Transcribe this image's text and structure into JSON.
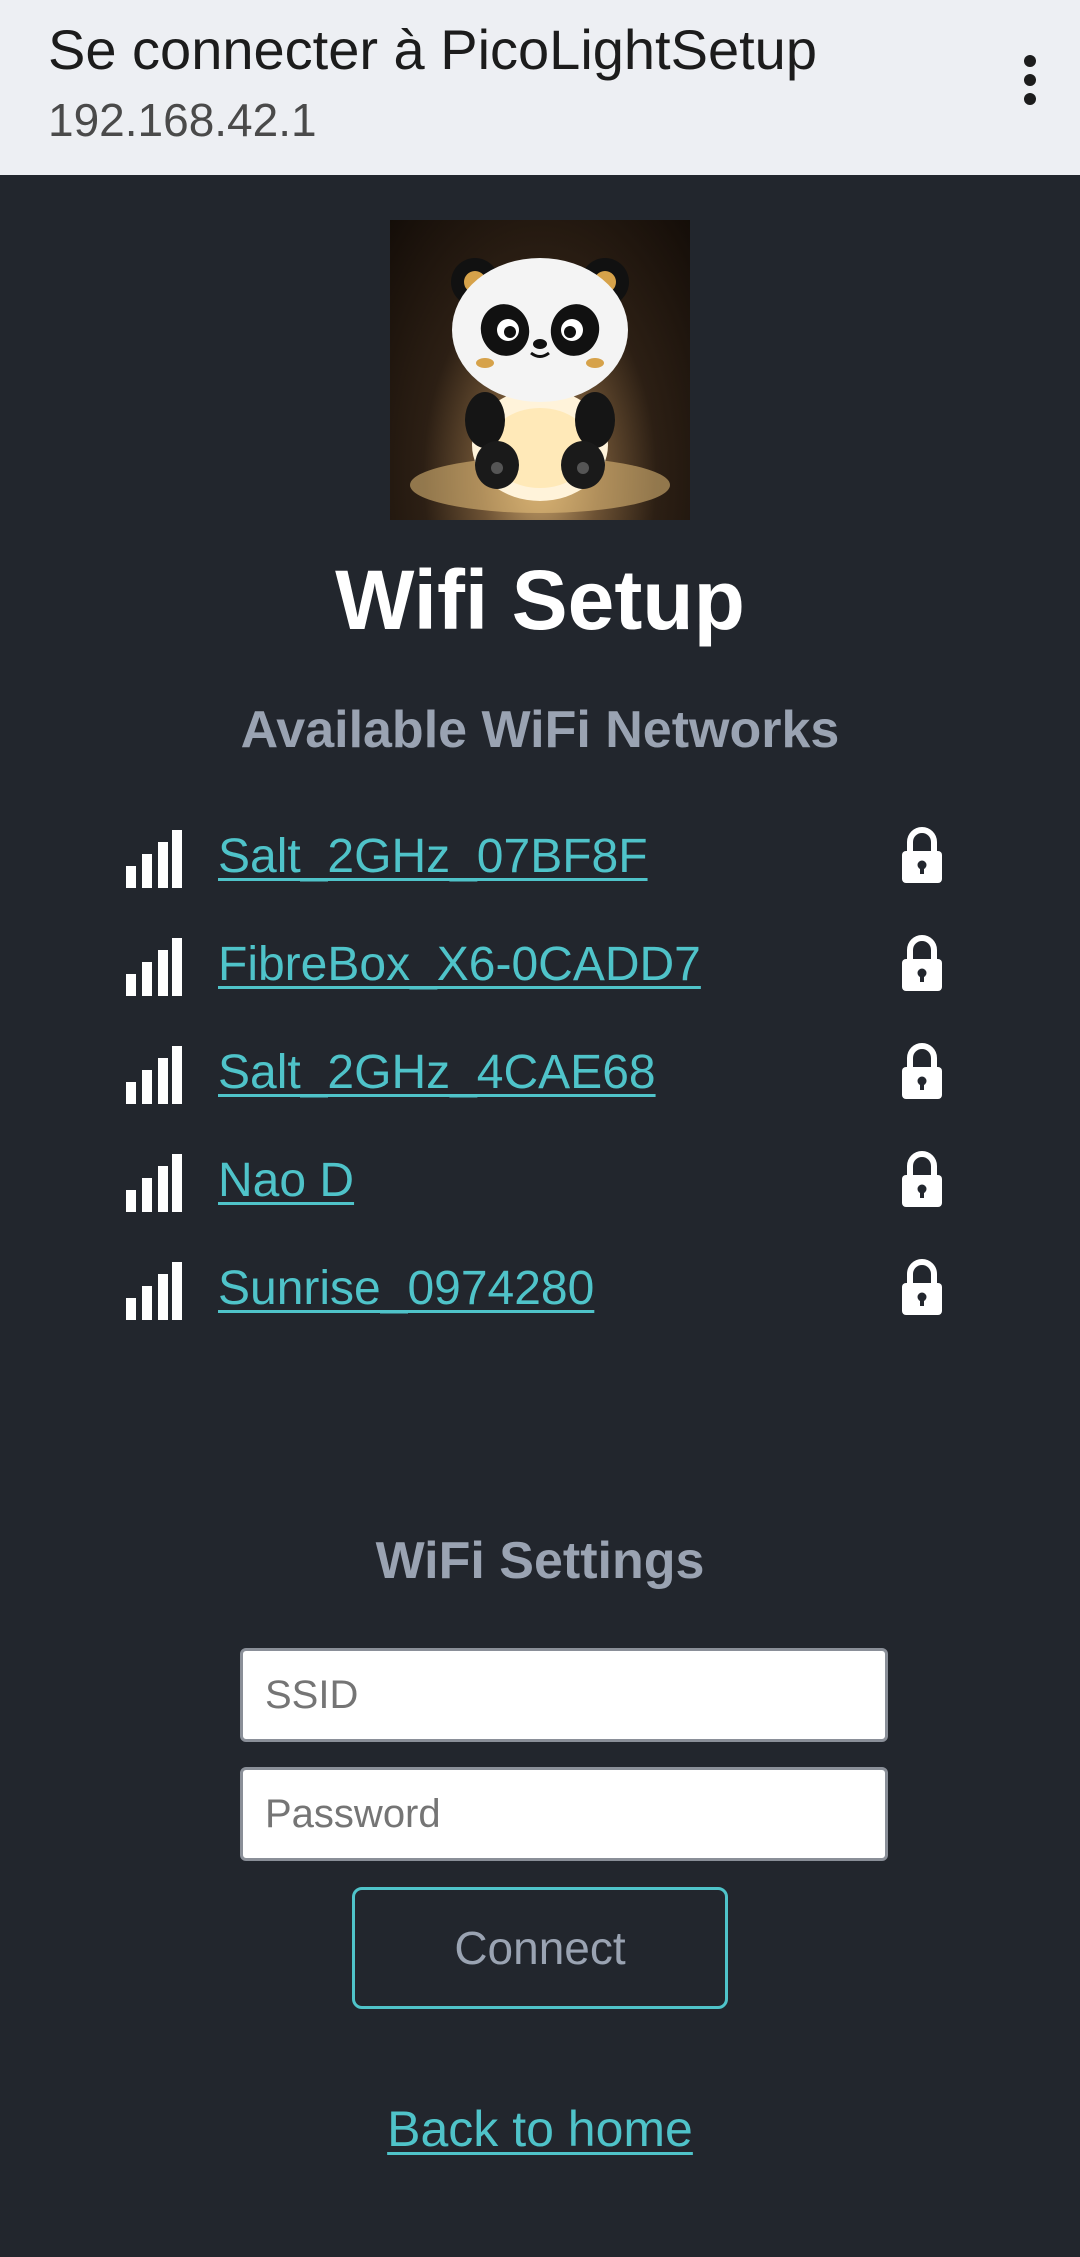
{
  "browser": {
    "title": "Se connecter à PicoLightSetup",
    "url": "192.168.42.1",
    "menu_icon": "more-vert-icon"
  },
  "page": {
    "logo_alt": "panda-lamp-logo",
    "heading": "Wifi Setup",
    "available_heading": "Available WiFi Networks",
    "networks": [
      {
        "ssid": "Salt_2GHz_07BF8F",
        "signal_icon": "signal-icon",
        "secured": true
      },
      {
        "ssid": "FibreBox_X6-0CADD7",
        "signal_icon": "signal-icon",
        "secured": true
      },
      {
        "ssid": "Salt_2GHz_4CAE68",
        "signal_icon": "signal-icon",
        "secured": true
      },
      {
        "ssid": "Nao D",
        "signal_icon": "signal-icon",
        "secured": true
      },
      {
        "ssid": "Sunrise_0974280",
        "signal_icon": "signal-icon",
        "secured": true
      }
    ],
    "settings_heading": "WiFi Settings",
    "ssid_placeholder": "SSID",
    "password_placeholder": "Password",
    "connect_label": "Connect",
    "back_link": "Back to home"
  },
  "colors": {
    "background": "#22262d",
    "accent": "#4fc3c9",
    "muted_text": "#9aa3b2",
    "topbar": "#edeff3"
  }
}
